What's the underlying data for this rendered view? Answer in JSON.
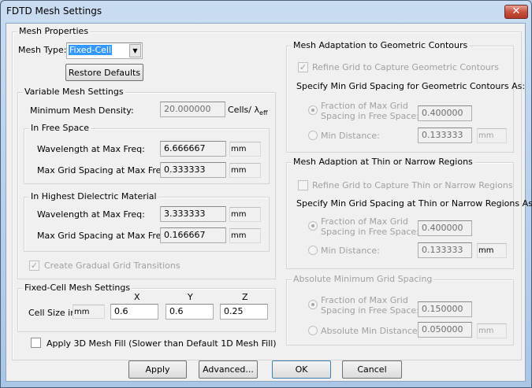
{
  "window": {
    "title": "FDTD Mesh Settings",
    "close_icon": "close-icon"
  },
  "mesh_properties": {
    "label": "Mesh Properties",
    "mesh_type_label": "Mesh Type:",
    "mesh_type_value": "Fixed-Cell",
    "restore_defaults": "Restore Defaults"
  },
  "variable_mesh": {
    "label": "Variable Mesh Settings",
    "min_density_label": "Minimum Mesh Density:",
    "min_density_value": "20.000000",
    "cells_unit": "Cells/ λ",
    "cells_unit_sub": "eff",
    "free_space": {
      "label": "In Free Space",
      "wavelength_label": "Wavelength at Max Freq:",
      "wavelength_value": "6.666667",
      "wavelength_unit": "mm",
      "spacing_label": "Max Grid Spacing at Max Freq:",
      "spacing_value": "0.333333",
      "spacing_unit": "mm"
    },
    "dielectric": {
      "label": "In Highest Dielectric Material",
      "wavelength_label": "Wavelength at Max Freq:",
      "wavelength_value": "3.333333",
      "wavelength_unit": "mm",
      "spacing_label": "Max Grid Spacing at Max Freq:",
      "spacing_value": "0.166667",
      "spacing_unit": "mm"
    },
    "gradual_label": "Create Gradual Grid Transitions",
    "gradual_checked": true
  },
  "fixed_cell": {
    "label": "Fixed-Cell Mesh Settings",
    "x_label": "X",
    "y_label": "Y",
    "z_label": "Z",
    "cell_size_label": "Cell Size in",
    "unit": "mm",
    "x": "0.6",
    "y": "0.6",
    "z": "0.25"
  },
  "mesh_fill": {
    "label": "Apply 3D Mesh Fill (Slower than Default 1D Mesh Fill)",
    "checked": false
  },
  "geometric": {
    "label": "Mesh Adaptation to Geometric Contours",
    "refine_label": "Refine Grid to Capture Geometric Contours",
    "refine_checked": true,
    "specify_label": "Specify Min Grid Spacing for Geometric Contours As:",
    "fraction_label_1": "Fraction of Max Grid",
    "fraction_label_2": "Spacing in Free Space:",
    "fraction_value": "0.400000",
    "min_label": "Min Distance:",
    "min_value": "0.133333",
    "min_unit": "mm",
    "selected": "fraction"
  },
  "thin": {
    "label": "Mesh Adaption at Thin or Narrow Regions",
    "refine_label": "Refine Grid to Capture Thin or Narrow Regions",
    "refine_checked": false,
    "specify_label": "Specify Min Grid Spacing at Thin or Narrow Regions As:",
    "fraction_label_1": "Fraction of Max Grid",
    "fraction_label_2": "Spacing in Free Space:",
    "fraction_value": "0.400000",
    "min_label": "Min Distance:",
    "min_value": "0.133333",
    "min_unit": "mm",
    "selected": "fraction"
  },
  "absolute": {
    "label": "Absolute Minimum Grid Spacing",
    "fraction_label_1": "Fraction of Max Grid",
    "fraction_label_2": "Spacing in Free Space:",
    "fraction_value": "0.150000",
    "min_label": "Absolute Min Distance:",
    "min_value": "0.050000",
    "min_unit": "mm",
    "selected": "fraction"
  },
  "buttons": {
    "apply": "Apply",
    "advanced": "Advanced...",
    "ok": "OK",
    "cancel": "Cancel"
  }
}
